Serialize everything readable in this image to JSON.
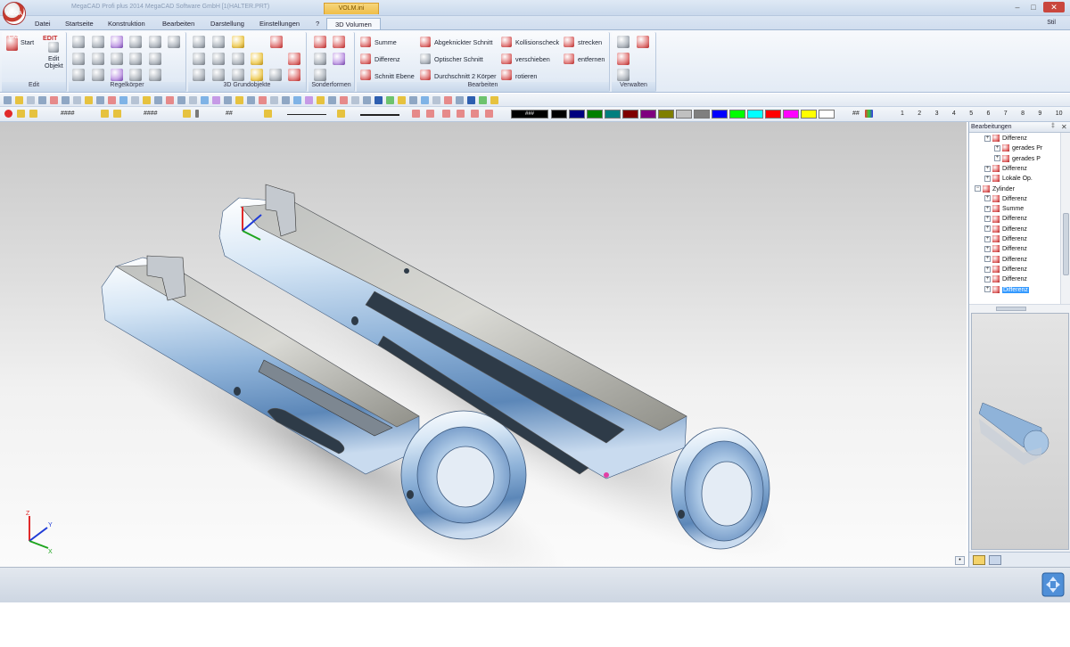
{
  "window": {
    "title": "MegaCAD Profi plus 2014  MegaCAD Software GmbH [1(HALTER.PRT)",
    "context_tab": "VOLM.ini",
    "logo_text": "MEGA CAD"
  },
  "tabs": [
    {
      "label": "Datei"
    },
    {
      "label": "Startseite"
    },
    {
      "label": "Konstruktion"
    },
    {
      "label": "Bearbeiten"
    },
    {
      "label": "Darstellung"
    },
    {
      "label": "Einstellungen"
    },
    {
      "label": "?"
    },
    {
      "label": "3D Volumen"
    }
  ],
  "style_label": "Stil",
  "ribbon": {
    "edit_group": {
      "label": "Edit",
      "start": "Start",
      "edit_top": "EDIT",
      "edit_objekt_1": "Edit",
      "edit_objekt_2": "Objekt"
    },
    "regel_group": {
      "label": "Regelkörper"
    },
    "grund_group": {
      "label": "3D Grundobjekte"
    },
    "sonder_group": {
      "label": "Sonderformen"
    },
    "bearbeiten_group": {
      "label": "Bearbeiten",
      "summe": "Summe",
      "differenz": "Differenz",
      "schnitt_ebene": "Schnitt Ebene",
      "abgeknickter_schnitt": "Abgeknickter Schnitt",
      "optischer_schnitt": "Optischer Schnitt",
      "durchschnitt": "Durchschnitt 2 Körper",
      "kollisionscheck": "Kollisionscheck",
      "verschieben": "verschieben",
      "rotieren": "rotieren",
      "strecken": "strecken",
      "entfernen": "entfernen"
    },
    "verwalten_group": {
      "label": "Verwalten"
    }
  },
  "toolbar2": {
    "field1": "####",
    "field2": "####",
    "field3": "##",
    "color_field": "###",
    "hash_label": "##",
    "numbers": [
      "1",
      "2",
      "3",
      "4",
      "5",
      "6",
      "7",
      "8",
      "9",
      "10"
    ]
  },
  "palette": [
    "#000000",
    "#00007f",
    "#007f00",
    "#007f7f",
    "#7f0000",
    "#7f007f",
    "#7f7f00",
    "#c0c0c0",
    "#7f7f7f",
    "#0000ff",
    "#00ff00",
    "#00ffff",
    "#ff0000",
    "#ff00ff",
    "#ffff00",
    "#ffffff"
  ],
  "panel": {
    "title": "Bearbeitungen",
    "tree": [
      {
        "label": "Differenz",
        "indent": 1,
        "sel": false
      },
      {
        "label": "gerades Pr",
        "indent": 2,
        "sel": false
      },
      {
        "label": "gerades P",
        "indent": 2,
        "sel": false
      },
      {
        "label": "Differenz",
        "indent": 1,
        "sel": false
      },
      {
        "label": "Lokale Op.",
        "indent": 1,
        "sel": false
      },
      {
        "label": "Zylinder",
        "indent": 0,
        "sel": false
      },
      {
        "label": "Differenz",
        "indent": 1,
        "sel": false
      },
      {
        "label": "Summe",
        "indent": 1,
        "sel": false
      },
      {
        "label": "Differenz",
        "indent": 1,
        "sel": false
      },
      {
        "label": "Differenz",
        "indent": 1,
        "sel": false
      },
      {
        "label": "Differenz",
        "indent": 1,
        "sel": false
      },
      {
        "label": "Differenz",
        "indent": 1,
        "sel": false
      },
      {
        "label": "Differenz",
        "indent": 1,
        "sel": false
      },
      {
        "label": "Differenz",
        "indent": 1,
        "sel": false
      },
      {
        "label": "Differenz",
        "indent": 1,
        "sel": false
      },
      {
        "label": "Differenz",
        "indent": 1,
        "sel": true
      }
    ]
  },
  "axes": {
    "x": "X",
    "y": "Y",
    "z": "Z"
  }
}
